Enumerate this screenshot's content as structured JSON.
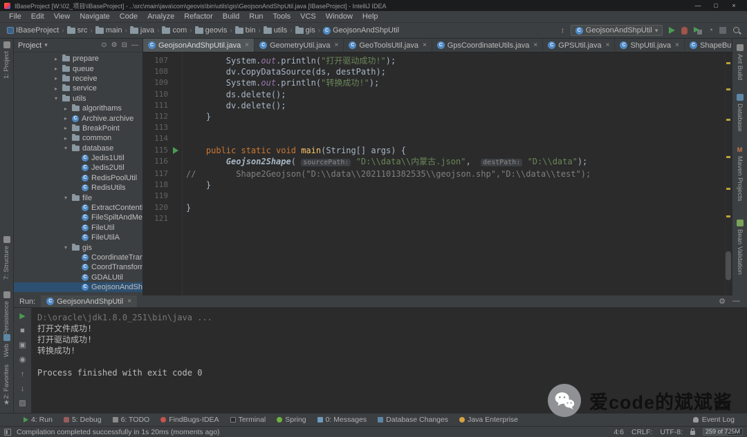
{
  "colors": {
    "accent_green": "#499C54",
    "keyword": "#cc7832",
    "string": "#6a8759",
    "comment": "#808080",
    "panel_bg": "#3c3f41",
    "editor_bg": "#2b2b2b",
    "warning_stripe": "#b8a33c"
  },
  "title_bar": {
    "title": "IBaseProject [W:\\02_项目\\IBaseProject] - ..\\src\\main\\java\\com\\geovis\\bin\\utils\\gis\\GeojsonAndShpUtil.java [IBaseProject] - IntelliJ IDEA",
    "controls": {
      "minimize": "—",
      "maximize": "□",
      "close": "×"
    }
  },
  "menu_bar": [
    "File",
    "Edit",
    "View",
    "Navigate",
    "Code",
    "Analyze",
    "Refactor",
    "Build",
    "Run",
    "Tools",
    "VCS",
    "Window",
    "Help"
  ],
  "nav_bar": {
    "breadcrumbs": [
      "IBaseProject",
      "src",
      "main",
      "java",
      "com",
      "geovis",
      "bin",
      "utils",
      "gis",
      "GeojsonAndShpUtil"
    ],
    "run_config": "GeojsonAndShpUtil",
    "action_icons": [
      "run",
      "debug",
      "coverage",
      "profiler",
      "stop",
      "search-everywhere"
    ]
  },
  "project_panel": {
    "title": "Project",
    "tree": [
      {
        "label": "prepare",
        "kind": "folder",
        "arrow": "right",
        "indent": 0
      },
      {
        "label": "queue",
        "kind": "folder",
        "arrow": "right",
        "indent": 0
      },
      {
        "label": "receive",
        "kind": "folder",
        "arrow": "right",
        "indent": 0
      },
      {
        "label": "service",
        "kind": "folder",
        "arrow": "right",
        "indent": 0
      },
      {
        "label": "utils",
        "kind": "folder",
        "arrow": "down",
        "indent": 0
      },
      {
        "label": "algorithams",
        "kind": "folder",
        "arrow": "right",
        "indent": 1
      },
      {
        "label": "Archive.archive",
        "kind": "class",
        "arrow": "right",
        "indent": 1
      },
      {
        "label": "BreakPoint",
        "kind": "folder",
        "arrow": "right",
        "indent": 1
      },
      {
        "label": "common",
        "kind": "folder",
        "arrow": "right",
        "indent": 1
      },
      {
        "label": "database",
        "kind": "folder",
        "arrow": "down",
        "indent": 1
      },
      {
        "label": "Jedis1Util",
        "kind": "class",
        "indent": 2
      },
      {
        "label": "Jedis2Util",
        "kind": "class",
        "indent": 2
      },
      {
        "label": "RedisPoolUtil",
        "kind": "class",
        "indent": 2
      },
      {
        "label": "RedisUtils",
        "kind": "class",
        "indent": 2
      },
      {
        "label": "file",
        "kind": "folder",
        "arrow": "down",
        "indent": 1
      },
      {
        "label": "ExtractContentF",
        "kind": "class",
        "indent": 2
      },
      {
        "label": "FileSpiltAndMer",
        "kind": "class",
        "indent": 2
      },
      {
        "label": "FileUtil",
        "kind": "class",
        "indent": 2
      },
      {
        "label": "FileUtilA",
        "kind": "class",
        "indent": 2
      },
      {
        "label": "gis",
        "kind": "folder",
        "arrow": "down",
        "indent": 1
      },
      {
        "label": "CoordinateTrans",
        "kind": "class",
        "indent": 2
      },
      {
        "label": "CoordTransform",
        "kind": "class",
        "indent": 2
      },
      {
        "label": "GDALUtil",
        "kind": "class",
        "indent": 2
      },
      {
        "label": "GeojsonAndShp",
        "kind": "class",
        "indent": 2,
        "selected": true
      }
    ]
  },
  "editor": {
    "tabs": [
      {
        "label": "GeojsonAndShpUtil.java",
        "active": true
      },
      {
        "label": "GeometryUtil.java"
      },
      {
        "label": "GeoToolsUtil.java"
      },
      {
        "label": "GpsCoordinateUtils.java"
      },
      {
        "label": "GPSUtil.java"
      },
      {
        "label": "ShpUtil.java"
      },
      {
        "label": "ShapeBufferUtil.java"
      }
    ],
    "lines": [
      {
        "num": 107,
        "seg": [
          {
            "t": "        System.",
            "c": "plain"
          },
          {
            "t": "out",
            "c": "field"
          },
          {
            "t": ".println(",
            "c": "plain"
          },
          {
            "t": "\"打开驱动成功!\"",
            "c": "str"
          },
          {
            "t": ");",
            "c": "plain"
          }
        ]
      },
      {
        "num": 108,
        "seg": [
          {
            "t": "        dv.CopyDataSource(ds, destPath);",
            "c": "plain"
          }
        ]
      },
      {
        "num": 109,
        "seg": [
          {
            "t": "        System.",
            "c": "plain"
          },
          {
            "t": "out",
            "c": "field"
          },
          {
            "t": ".println(",
            "c": "plain"
          },
          {
            "t": "\"转换成功!\"",
            "c": "str"
          },
          {
            "t": ");",
            "c": "plain"
          }
        ]
      },
      {
        "num": 110,
        "seg": [
          {
            "t": "        ds.delete();",
            "c": "plain"
          }
        ]
      },
      {
        "num": 111,
        "seg": [
          {
            "t": "        dv.delete();",
            "c": "plain"
          }
        ]
      },
      {
        "num": 112,
        "seg": [
          {
            "t": "    }",
            "c": "plain"
          }
        ]
      },
      {
        "num": 113,
        "seg": []
      },
      {
        "num": 114,
        "seg": []
      },
      {
        "num": 115,
        "run": true,
        "seg": [
          {
            "t": "    ",
            "c": "plain"
          },
          {
            "t": "public static void ",
            "c": "kw"
          },
          {
            "t": "main",
            "c": "method"
          },
          {
            "t": "(String[] args) {",
            "c": "plain"
          }
        ]
      },
      {
        "num": 116,
        "seg": [
          {
            "t": "        ",
            "c": "plain"
          },
          {
            "t": "Geojson2Shape",
            "c": "static"
          },
          {
            "t": "( ",
            "c": "plain"
          },
          {
            "t": "sourcePath:",
            "c": "hint"
          },
          {
            "t": " ",
            "c": "plain"
          },
          {
            "t": "\"D:\\\\data\\\\内蒙古.json\"",
            "c": "str"
          },
          {
            "t": ",  ",
            "c": "plain"
          },
          {
            "t": "destPath:",
            "c": "hint"
          },
          {
            "t": " ",
            "c": "plain"
          },
          {
            "t": "\"D:\\\\data\"",
            "c": "str"
          },
          {
            "t": ");",
            "c": "plain"
          }
        ]
      },
      {
        "num": 117,
        "seg": [
          {
            "t": "//        Shape2Geojson(\"D:\\\\data\\\\2021101382535\\\\geojson.shp\",\"D:\\\\data\\\\test\");",
            "c": "cmt"
          }
        ]
      },
      {
        "num": 118,
        "seg": [
          {
            "t": "    }",
            "c": "plain"
          }
        ]
      },
      {
        "num": 119,
        "seg": []
      },
      {
        "num": 120,
        "seg": [
          {
            "t": "}",
            "c": "plain"
          }
        ]
      },
      {
        "num": 121,
        "seg": []
      }
    ]
  },
  "run_panel": {
    "label": "Run:",
    "tab": "GeojsonAndShpUtil",
    "toolbar_icons": [
      "rerun",
      "stop",
      "restore-layout",
      "pin",
      "scroll-up",
      "scroll-down",
      "clear"
    ],
    "console": [
      {
        "text": "D:\\oracle\\jdk1.8.0_251\\bin\\java ...",
        "style": "cmd"
      },
      {
        "text": "打开文件成功!",
        "style": "out"
      },
      {
        "text": "打开驱动成功!",
        "style": "out"
      },
      {
        "text": "转换成功!",
        "style": "out"
      },
      {
        "text": "",
        "style": "out"
      },
      {
        "text": "Process finished with exit code 0",
        "style": "out"
      }
    ]
  },
  "left_stripe": {
    "top": [
      {
        "label": "1: Project",
        "icon": "project"
      }
    ],
    "middle": [
      {
        "label": "7: Structure",
        "icon": "structure"
      }
    ],
    "bottom": [
      {
        "label": "Persistence",
        "icon": "persistence"
      },
      {
        "label": "Web",
        "icon": "web"
      },
      {
        "label": "2: Favorites",
        "icon": "favorites"
      }
    ]
  },
  "right_stripe": [
    {
      "label": "Ant Build",
      "icon": "ant"
    },
    {
      "label": "Database",
      "icon": "database"
    },
    {
      "label": "Maven Projects",
      "icon": "maven"
    },
    {
      "label": "Bean Validation",
      "icon": "bean"
    }
  ],
  "bottom_bar": {
    "items": [
      {
        "label": "4: Run",
        "icon": "run"
      },
      {
        "label": "5: Debug",
        "icon": "debug"
      },
      {
        "label": "6: TODO",
        "icon": "todo"
      },
      {
        "label": "FindBugs-IDEA",
        "icon": "findbugs"
      },
      {
        "label": "Terminal",
        "icon": "terminal"
      },
      {
        "label": "Spring",
        "icon": "spring"
      },
      {
        "label": "0: Messages",
        "icon": "messages"
      },
      {
        "label": "Database Changes",
        "icon": "database"
      },
      {
        "label": "Java Enterprise",
        "icon": "java-ee"
      }
    ],
    "event_log": "Event Log"
  },
  "status_bar": {
    "message": "Compilation completed successfully in 1s 20ms (moments ago)",
    "caret": "4:6",
    "line_ending": "CRLF:",
    "encoding": "UTF-8:",
    "memory": "259 of 725M"
  },
  "watermark": {
    "text": "爱code的斌斌酱"
  }
}
